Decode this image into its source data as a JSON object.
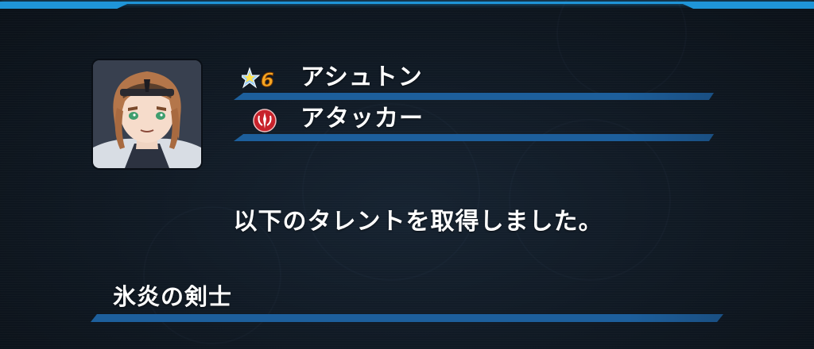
{
  "character": {
    "name": "アシュトン",
    "role": "アタッカー",
    "rarity": "6",
    "rarity_icon": "star-rarity-icon",
    "role_icon": "attacker-crest-icon"
  },
  "message": "以下のタレントを取得しました。",
  "talent": {
    "name": "氷炎の剣士"
  },
  "colors": {
    "frame_accent": "#1f95d8",
    "bar_blue": "#1d5f9c",
    "background": "#0e151e",
    "rarity_number": "#f5a623",
    "role_crest": "#c8222b"
  }
}
